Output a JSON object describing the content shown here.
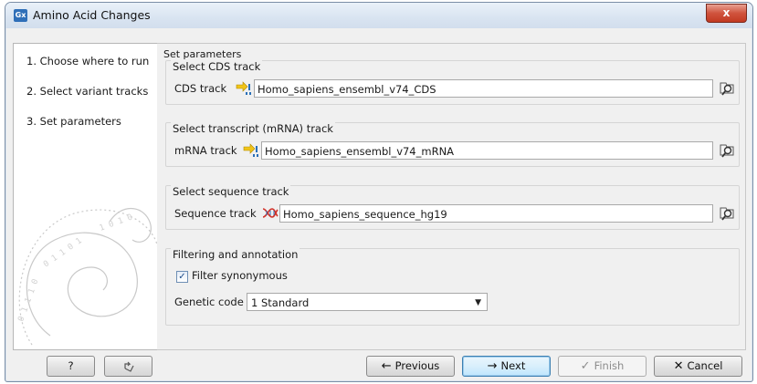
{
  "window": {
    "icon_text": "Gx",
    "title": "Amino Acid Changes",
    "close_label": "x"
  },
  "sidebar": {
    "steps": [
      {
        "number": "1.",
        "label": "Choose where to run"
      },
      {
        "number": "2.",
        "label": "Select variant tracks"
      },
      {
        "number": "3.",
        "label": "Set parameters"
      }
    ]
  },
  "content": {
    "title": "Set parameters",
    "cds_group": {
      "title": "Select CDS track",
      "label": "CDS track",
      "value": "Homo_sapiens_ensembl_v74_CDS",
      "icon": "annotation-track-icon"
    },
    "mrna_group": {
      "title": "Select transcript (mRNA) track",
      "label": "mRNA track",
      "value": "Homo_sapiens_ensembl_v74_mRNA",
      "icon": "annotation-track-icon"
    },
    "sequence_group": {
      "title": "Select sequence track",
      "label": "Sequence track",
      "value": "Homo_sapiens_sequence_hg19",
      "icon": "sequence-track-icon"
    },
    "filtering_group": {
      "title": "Filtering and annotation",
      "filter_synonymous": {
        "label": "Filter synonymous",
        "checked": true
      },
      "genetic_code": {
        "label": "Genetic code",
        "value": "1 Standard"
      }
    }
  },
  "footer": {
    "help_label": "?",
    "previous_label": "Previous",
    "next_label": "Next",
    "finish_label": "Finish",
    "cancel_label": "Cancel"
  },
  "colors": {
    "accent": "#3c7fb1",
    "close": "#c23a22",
    "track_icon": "#e6b800"
  }
}
